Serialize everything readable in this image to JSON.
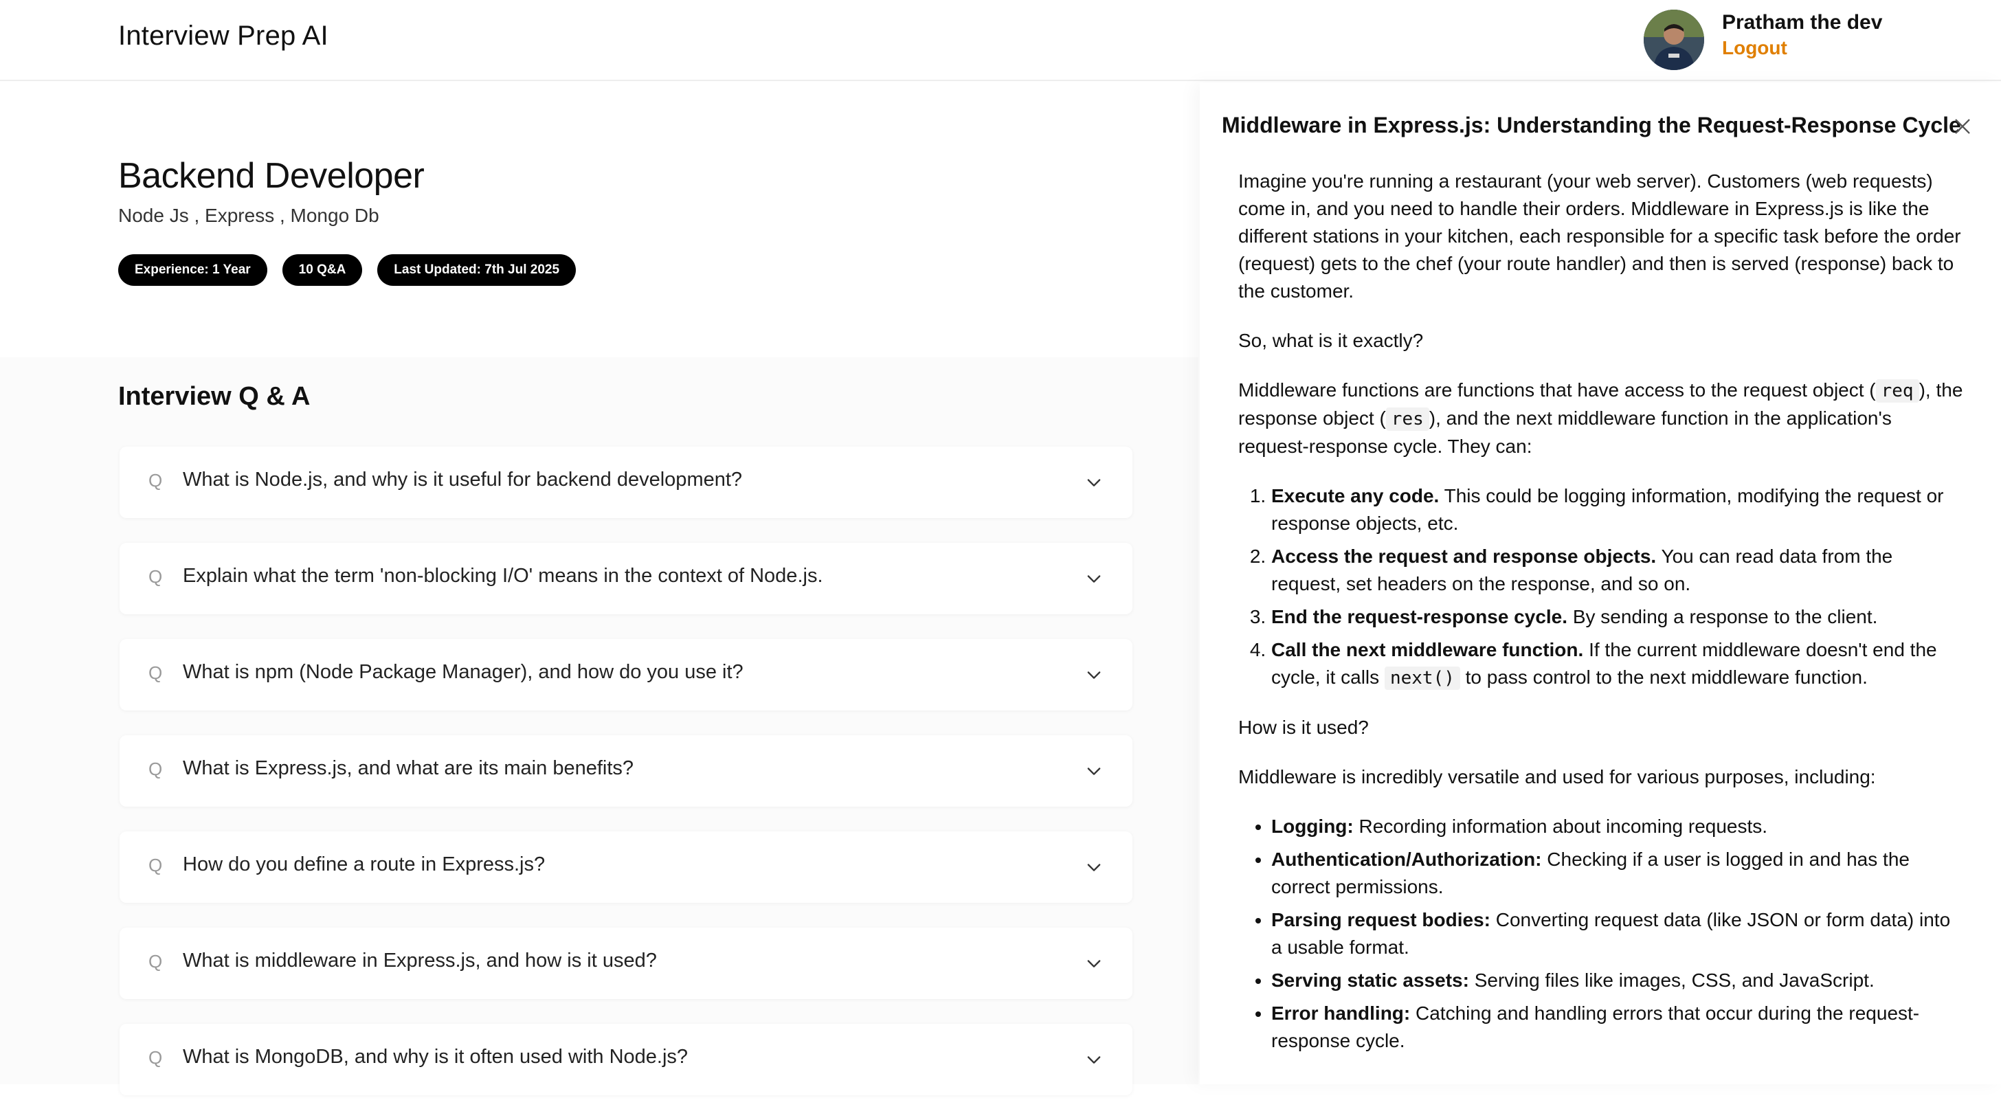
{
  "header": {
    "app_title": "Interview Prep AI",
    "user_name": "Pratham the dev",
    "logout_label": "Logout"
  },
  "session": {
    "role": "Backend Developer",
    "topics": "Node Js , Express , Mongo Db",
    "badges": [
      "Experience: 1 Year",
      "10 Q&A",
      "Last Updated: 7th Jul 2025"
    ]
  },
  "qa": {
    "heading": "Interview Q & A",
    "question_icon": "Q",
    "questions": [
      "What is Node.js, and why is it useful for backend development?",
      "Explain what the term 'non-blocking I/O' means in the context of Node.js.",
      "What is npm (Node Package Manager), and how do you use it?",
      "What is Express.js, and what are its main benefits?",
      "How do you define a route in Express.js?",
      "What is middleware in Express.js, and how is it used?",
      "What is MongoDB, and why is it often used with Node.js?"
    ]
  },
  "drawer": {
    "title": "Middleware in Express.js: Understanding the Request-Response Cycle",
    "intro": "Imagine you're running a restaurant (your web server). Customers (web requests) come in, and you need to handle their orders. Middleware in Express.js is like the different stations in your kitchen, each responsible for a specific task before the order (request) gets to the chef (your route handler) and then is served (response) back to the customer.",
    "q1": "So, what is it exactly?",
    "def_part1": "Middleware functions are functions that have access to the request object (",
    "def_code1": "req",
    "def_part2": "), the response object (",
    "def_code2": "res",
    "def_part3": "), and the next middleware function in the application's request-response cycle. They can:",
    "steps": [
      {
        "bold": "Execute any code.",
        "text": " This could be logging information, modifying the request or response objects, etc."
      },
      {
        "bold": "Access the request and response objects.",
        "text": " You can read data from the request, set headers on the response, and so on."
      },
      {
        "bold": "End the request-response cycle.",
        "text": " By sending a response to the client."
      },
      {
        "bold": "Call the next middleware function.",
        "text_before": " If the current middleware doesn't end the cycle, it calls ",
        "code": "next()",
        "text_after": " to pass control to the next middleware function."
      }
    ],
    "q2": "How is it used?",
    "uses_intro": "Middleware is incredibly versatile and used for various purposes, including:",
    "uses": [
      {
        "bold": "Logging:",
        "text": " Recording information about incoming requests."
      },
      {
        "bold": "Authentication/Authorization:",
        "text": " Checking if a user is logged in and has the correct permissions."
      },
      {
        "bold": "Parsing request bodies:",
        "text": " Converting request data (like JSON or form data) into a usable format."
      },
      {
        "bold": "Serving static assets:",
        "text": " Serving files like images, CSS, and JavaScript."
      },
      {
        "bold": "Error handling:",
        "text": " Catching and handling errors that occur during the request-response cycle."
      }
    ]
  },
  "colors": {
    "accent": "#e07f00",
    "badge_bg": "#000000",
    "qa_bg": "#fbfbfb"
  },
  "icons": {
    "avatar": "user-avatar",
    "chevron": "chevron-down-icon",
    "close": "close-icon"
  }
}
